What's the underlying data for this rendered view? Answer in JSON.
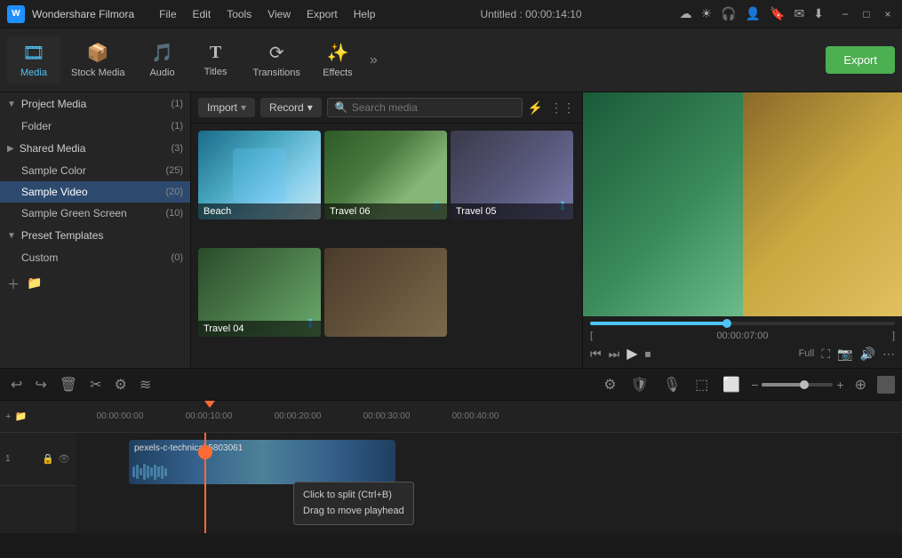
{
  "titlebar": {
    "logo": "W",
    "appname": "Wondershare Filmora",
    "menus": [
      "File",
      "Edit",
      "Tools",
      "View",
      "Export",
      "Help"
    ],
    "title": "Untitled : 00:00:14:10",
    "controls": [
      "−",
      "□",
      "×"
    ]
  },
  "toolbar": {
    "items": [
      {
        "id": "media",
        "icon": "🎞",
        "label": "Media",
        "active": true
      },
      {
        "id": "stock",
        "icon": "📦",
        "label": "Stock Media",
        "active": false
      },
      {
        "id": "audio",
        "icon": "🎵",
        "label": "Audio",
        "active": false
      },
      {
        "id": "titles",
        "icon": "T",
        "label": "Titles",
        "active": false
      },
      {
        "id": "transitions",
        "icon": "⟳",
        "label": "Transitions",
        "active": false
      },
      {
        "id": "effects",
        "icon": "✨",
        "label": "Effects",
        "active": false
      }
    ],
    "export_label": "Export"
  },
  "sidebar": {
    "sections": [
      {
        "id": "project-media",
        "label": "Project Media",
        "count": "(1)",
        "expanded": true,
        "items": [
          {
            "id": "folder",
            "label": "Folder",
            "count": "(1)",
            "active": false
          }
        ]
      },
      {
        "id": "shared-media",
        "label": "Shared Media",
        "count": "(3)",
        "expanded": false,
        "items": [
          {
            "id": "sample-color",
            "label": "Sample Color",
            "count": "(25)",
            "active": false
          },
          {
            "id": "sample-video",
            "label": "Sample Video",
            "count": "(20)",
            "active": true
          },
          {
            "id": "sample-green",
            "label": "Sample Green Screen",
            "count": "(10)",
            "active": false
          }
        ]
      },
      {
        "id": "preset-templates",
        "label": "Preset Templates",
        "count": "",
        "expanded": true,
        "items": [
          {
            "id": "custom",
            "label": "Custom",
            "count": "(0)",
            "active": false
          }
        ]
      }
    ],
    "bottom_icons": [
      "+",
      "📁"
    ]
  },
  "content": {
    "import_label": "Import",
    "record_label": "Record",
    "search_placeholder": "Search media",
    "media_items": [
      {
        "id": "beach",
        "label": "Beach",
        "class": "thumb-beach",
        "has_download": false
      },
      {
        "id": "travel06",
        "label": "Travel 06",
        "class": "thumb-travel06",
        "has_download": true
      },
      {
        "id": "travel05",
        "label": "Travel 05",
        "class": "thumb-travel05",
        "has_download": true
      },
      {
        "id": "travel04",
        "label": "Travel 04",
        "class": "thumb-travel04",
        "has_download": true
      },
      {
        "id": "partial",
        "label": "",
        "class": "thumb-partial",
        "has_download": false
      }
    ]
  },
  "preview": {
    "time_current": "00:00:07:00",
    "time_brackets": [
      "[",
      "]"
    ],
    "progress_percent": 45,
    "fullscreen_label": "Full",
    "controls": [
      "⏮",
      "⏭",
      "▶",
      "⏹"
    ]
  },
  "timeline": {
    "rulers": [
      "00:00:00:00",
      "00:00:10:00",
      "00:00:20:00",
      "00:00:30:00",
      "00:00:40:00"
    ],
    "playhead_pos": "00:00:14:10",
    "clip_label": "pexels-c-technical-5803061",
    "tooltip_line1": "Click to split (Ctrl+B)",
    "tooltip_line2": "Drag to move playhead",
    "zoom_minus": "−",
    "zoom_plus": "+",
    "track_icons": [
      "🔒",
      "👁"
    ]
  }
}
